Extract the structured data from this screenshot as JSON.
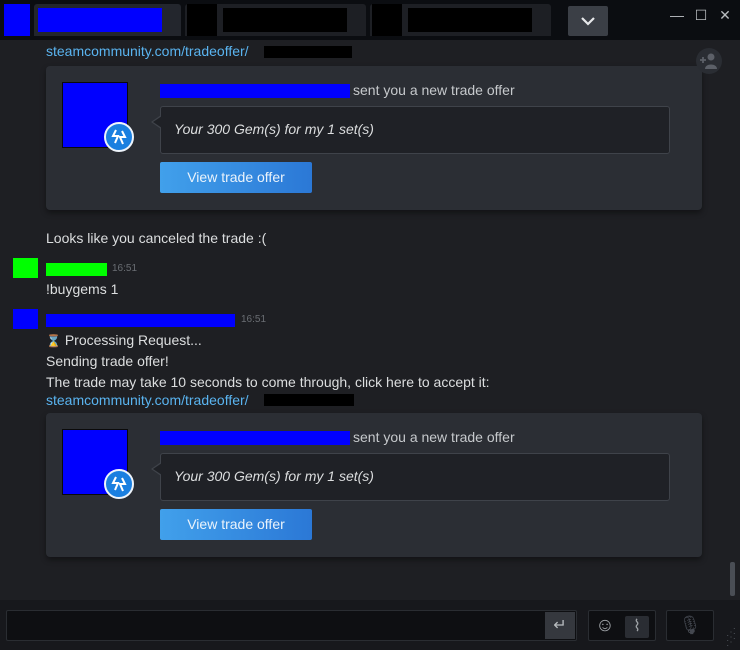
{
  "tabs": [
    {
      "redacted": true,
      "active": true
    },
    {
      "redacted": true,
      "active": false
    },
    {
      "redacted": true,
      "active": false
    }
  ],
  "icons": {
    "tab_close": "✕",
    "dropdown": "⌄",
    "minimize": "—",
    "maximize": "☐",
    "close": "✕",
    "send": "↵",
    "emoji": "☺",
    "attach": "⌇",
    "voice": "🎙"
  },
  "messages": {
    "link_prefix": "steamcommunity.com/tradeoffer/",
    "canceled_text": "Looks like you canceled the trade :(",
    "user_message": "!buygems 1",
    "user_time": "16:51",
    "bot_time": "16:51",
    "processing_icon": "⌛",
    "processing_text": "Processing Request...",
    "sending_text": "Sending trade offer!",
    "accept_text": "The trade may take 10 seconds to come through, click here to accept it:"
  },
  "trade_cards": [
    {
      "sent_text": "sent you a new trade offer",
      "offer_text": "Your 300 Gem(s) for my 1 set(s)",
      "button_label": "View trade offer"
    },
    {
      "sent_text": "sent you a new trade offer",
      "offer_text": "Your 300 Gem(s) for my 1 set(s)",
      "button_label": "View trade offer"
    }
  ],
  "colors": {
    "link": "#5ab4f0",
    "button": "#2b78d6",
    "redacted_blue": "#0000ff",
    "redacted_green": "#00ff00"
  }
}
